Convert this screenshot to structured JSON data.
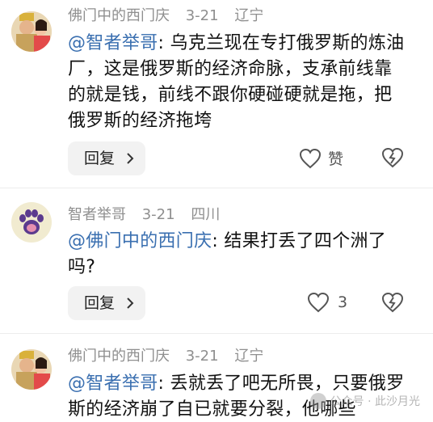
{
  "comments": [
    {
      "author": "佛门中的西门庆",
      "date": "3-21",
      "location": "辽宁",
      "mention": "@智者举哥",
      "text": ": 乌克兰现在专打俄罗斯的炼油厂，这是俄罗斯的经济命脉，支承前线靠的就是钱，前线不跟你硬碰硬就是拖，把俄罗斯的经济拖垮",
      "reply_label": "回复",
      "like_label": "赞"
    },
    {
      "author": "智者举哥",
      "date": "3-21",
      "location": "四川",
      "mention": "@佛门中的西门庆",
      "text": ": 结果打丢了四个洲了吗?",
      "reply_label": "回复",
      "like_count": "3"
    },
    {
      "author": "佛门中的西门庆",
      "date": "3-21",
      "location": "辽宁",
      "mention": "@智者举哥",
      "text": ": 丢就丢了吧无所畏，只要俄罗斯的经济崩了自已就要分裂，他哪些"
    }
  ],
  "watermark": {
    "text": "公众号 · 此沙月光"
  },
  "icons": {
    "avatar_1": "man-with-crown-and-woman-avatar",
    "avatar_2": "paw-print-avatar",
    "like": "heart-icon",
    "dislike": "broken-heart-icon",
    "reply_chevron": "chevron-right-icon"
  },
  "colors": {
    "mention": "#3a6fb0",
    "meta": "#8f8f8f",
    "text": "#111111",
    "reply_bg": "#f2f2f2"
  }
}
